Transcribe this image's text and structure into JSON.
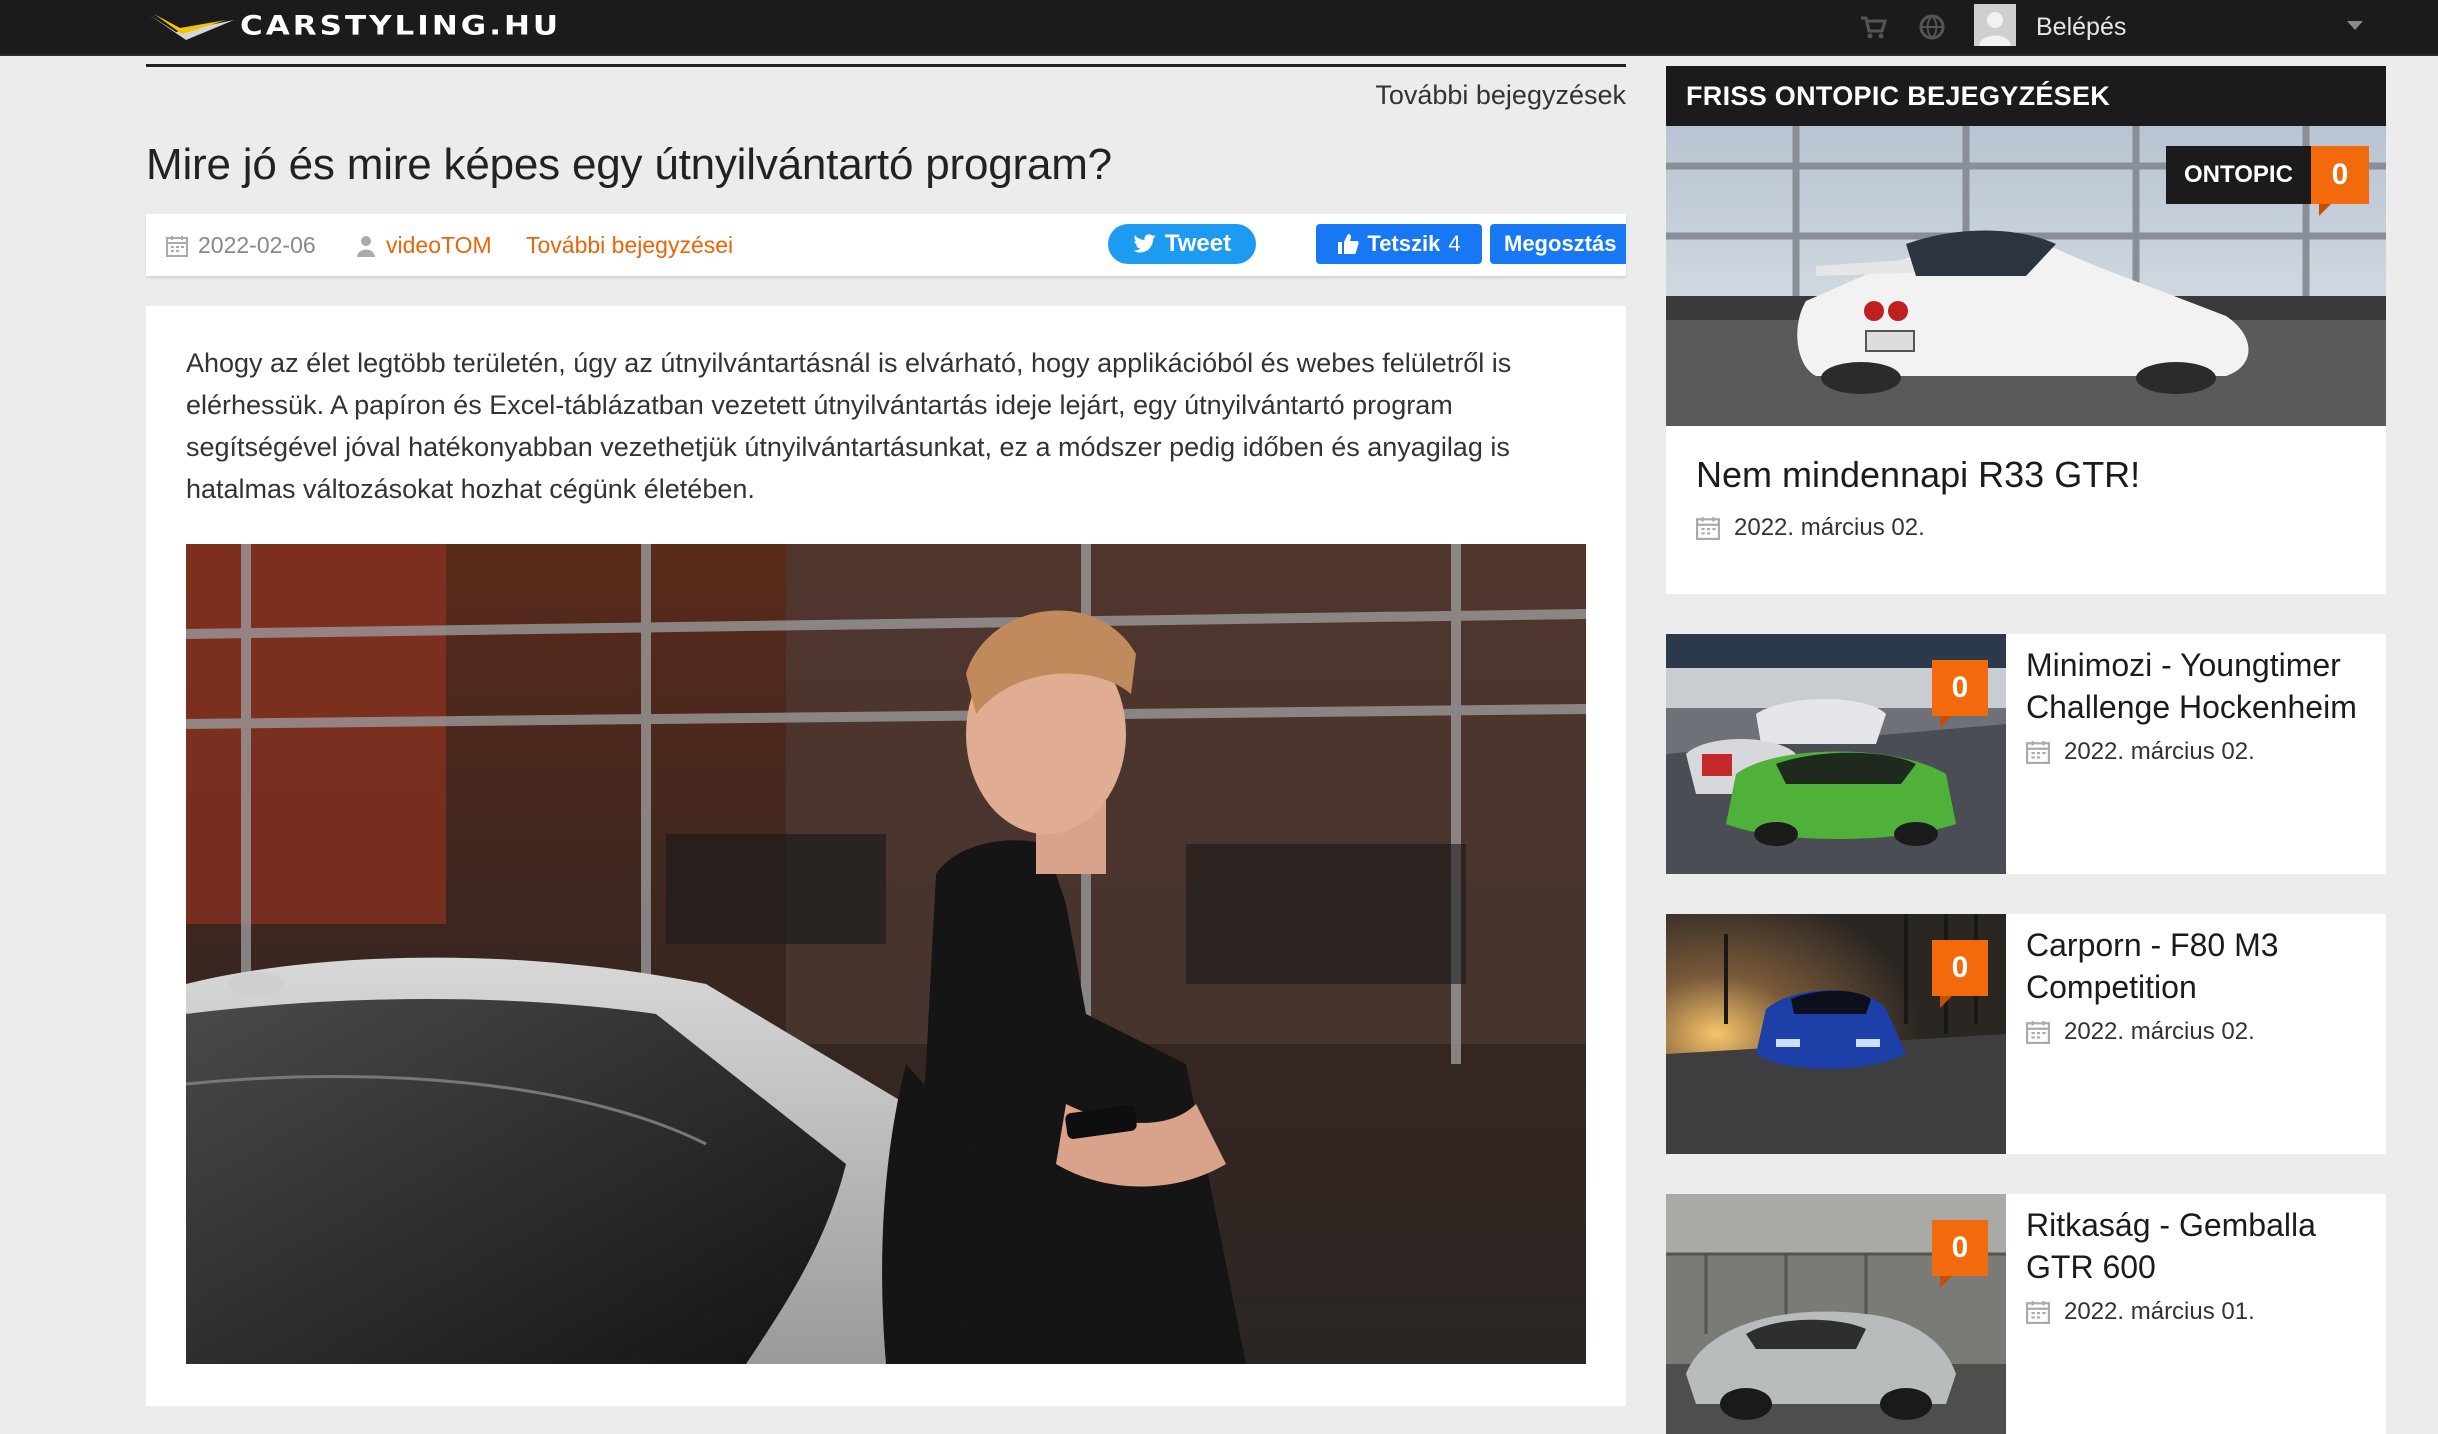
{
  "header": {
    "logo_text": "CARSTYLING.HU",
    "login_label": "Belépés",
    "icons": [
      "cart-icon",
      "globe-icon",
      "avatar",
      "chevron-down-icon"
    ]
  },
  "article": {
    "more_posts_link": "További bejegyzések",
    "title": "Mire jó és mire képes egy útnyilvántartó program?",
    "meta": {
      "date": "2022-02-06",
      "author": "videoTOM",
      "author_more": "További bejegyzései"
    },
    "social": {
      "tweet_label": "Tweet",
      "like_label": "Tetszik",
      "like_count": "4",
      "share_label": "Megosztás"
    },
    "lead_text": "Ahogy az élet legtöbb területén, úgy az útnyilvántartásnál is elvárható, hogy applikációból és webes felületről is elérhessük. A papíron és Excel-táblázatban vezetett útnyilvántartás ideje lejárt, egy útnyilvántartó program segítségével jóval hatékonyabban vezethetjük útnyilvántartásunkat, ez a módszer pedig időben és anyagilag is hatalmas változásokat hozhat cégünk életében."
  },
  "sidebar": {
    "header": "FRISS ONTOPIC BEJEGYZÉSEK",
    "featured": {
      "badge_label": "ONTOPIC",
      "comment_count": "0",
      "title": "Nem mindennapi R33 GTR!",
      "date": "2022. március 02."
    },
    "items": [
      {
        "title": "Minimozi - Youngtimer Challenge Hockenheim",
        "date": "2022. március 02.",
        "comment_count": "0"
      },
      {
        "title": "Carporn - F80 M3 Competition",
        "date": "2022. március 02.",
        "comment_count": "0"
      },
      {
        "title": "Ritkaság - Gemballa GTR 600",
        "date": "2022. március 01.",
        "comment_count": "0"
      }
    ]
  },
  "colors": {
    "accent": "#e8650a",
    "badge": "#f26a0c",
    "topbar": "#1b1b1b",
    "twitter": "#1d9bf0",
    "facebook": "#1877f2"
  }
}
